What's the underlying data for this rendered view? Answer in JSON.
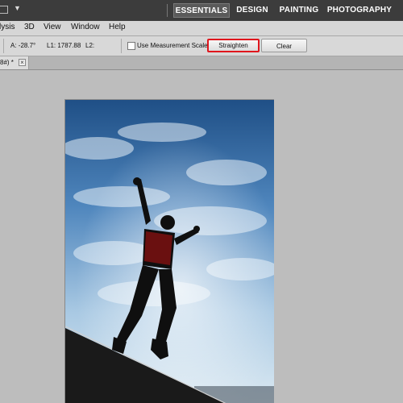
{
  "workspaces": {
    "essentials": "ESSENTIALS",
    "design": "DESIGN",
    "painting": "PAINTING",
    "photography": "PHOTOGRAPHY",
    "active": "essentials"
  },
  "doc_arrow": "▼",
  "menu": {
    "items": [
      "lysis",
      "3D",
      "View",
      "Window",
      "Help"
    ]
  },
  "ruler_options": {
    "angle": "A: -28.7°",
    "length1": "L1: 1787.88",
    "length2": "L2:",
    "use_measurement_scale_label": "Use Measurement Scale",
    "straighten_label": "Straighten",
    "clear_label": "Clear",
    "highlight_color": "#e0161d"
  },
  "document_tab": {
    "label": "8#) *",
    "close_glyph": "×"
  },
  "canvas": {
    "image_description_icon": "photo-silhouette-jumping-person"
  }
}
